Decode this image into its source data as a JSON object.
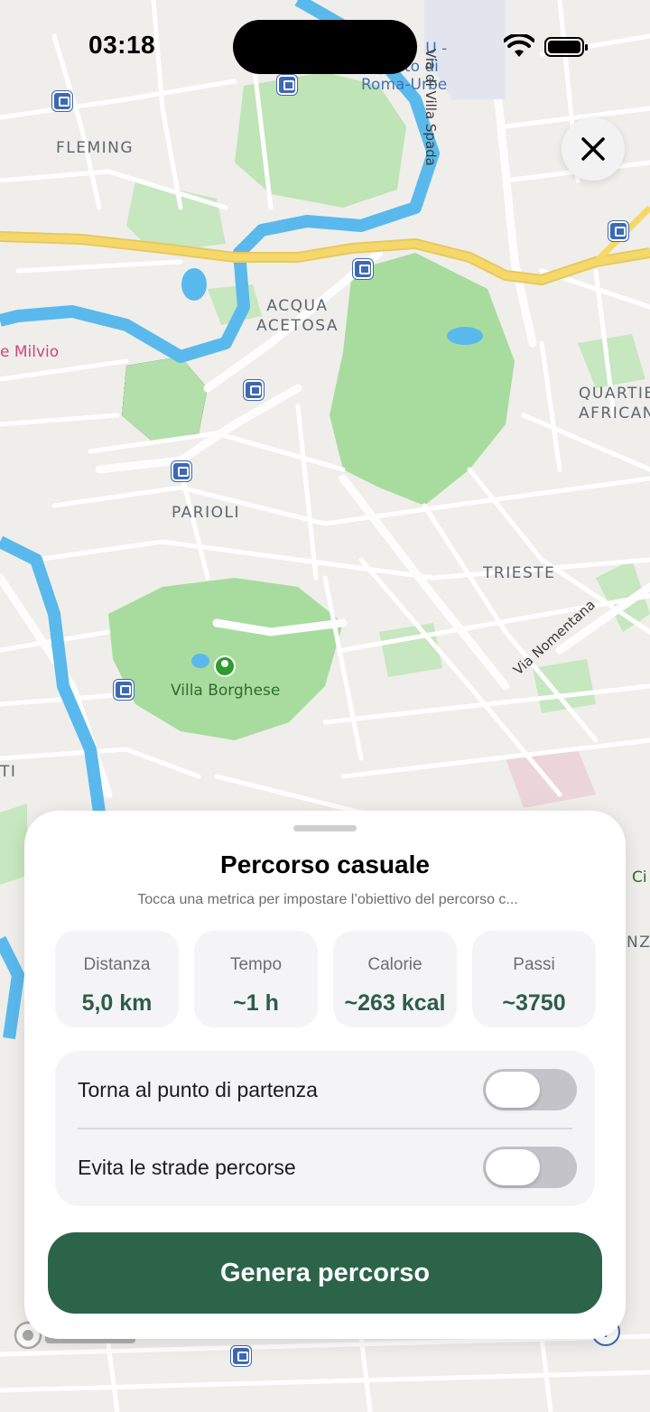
{
  "status_bar": {
    "time": "03:18"
  },
  "map": {
    "labels": {
      "fleming": "FLEMING",
      "acqua_acetosa_1": "ACQUA",
      "acqua_acetosa_2": "ACETOSA",
      "parioli": "PARIOLI",
      "trieste": "TRIESTE",
      "quartiere_1": "QUARTIE",
      "quartiere_2": "AFRICAN",
      "villa_borghese": "Villa Borghese",
      "ponte_milvio": "e Milvio",
      "aeroporto_1": "U -",
      "aeroporto_2": "oporto di",
      "aeroporto_3": "Roma-Urbe",
      "via_villa_spada": "Via di Villa Spada",
      "via_nomentana": "Via Nomentana",
      "edge_ci": "Ci",
      "edge_nzo": "NZO",
      "edge_ti": "TI"
    },
    "info_button": "i"
  },
  "sheet": {
    "title": "Percorso casuale",
    "subtitle": "Tocca una metrica per impostare l’obiettivo del percorso c...",
    "metrics": [
      {
        "label": "Distanza",
        "value": "5,0 km"
      },
      {
        "label": "Tempo",
        "value": "~1 h"
      },
      {
        "label": "Calorie",
        "value": "~263 kcal"
      },
      {
        "label": "Passi",
        "value": "~3750"
      }
    ],
    "toggles": [
      {
        "label": "Torna al punto di partenza",
        "on": false
      },
      {
        "label": "Evita le strade percorse",
        "on": false
      }
    ],
    "generate_button": "Genera percorso"
  },
  "colors": {
    "accent_green": "#2b6449",
    "metric_value_green": "#2d5e45",
    "map_park": "#a5dea0",
    "map_water": "#5ab9ec",
    "map_highway": "#f5d86a"
  }
}
